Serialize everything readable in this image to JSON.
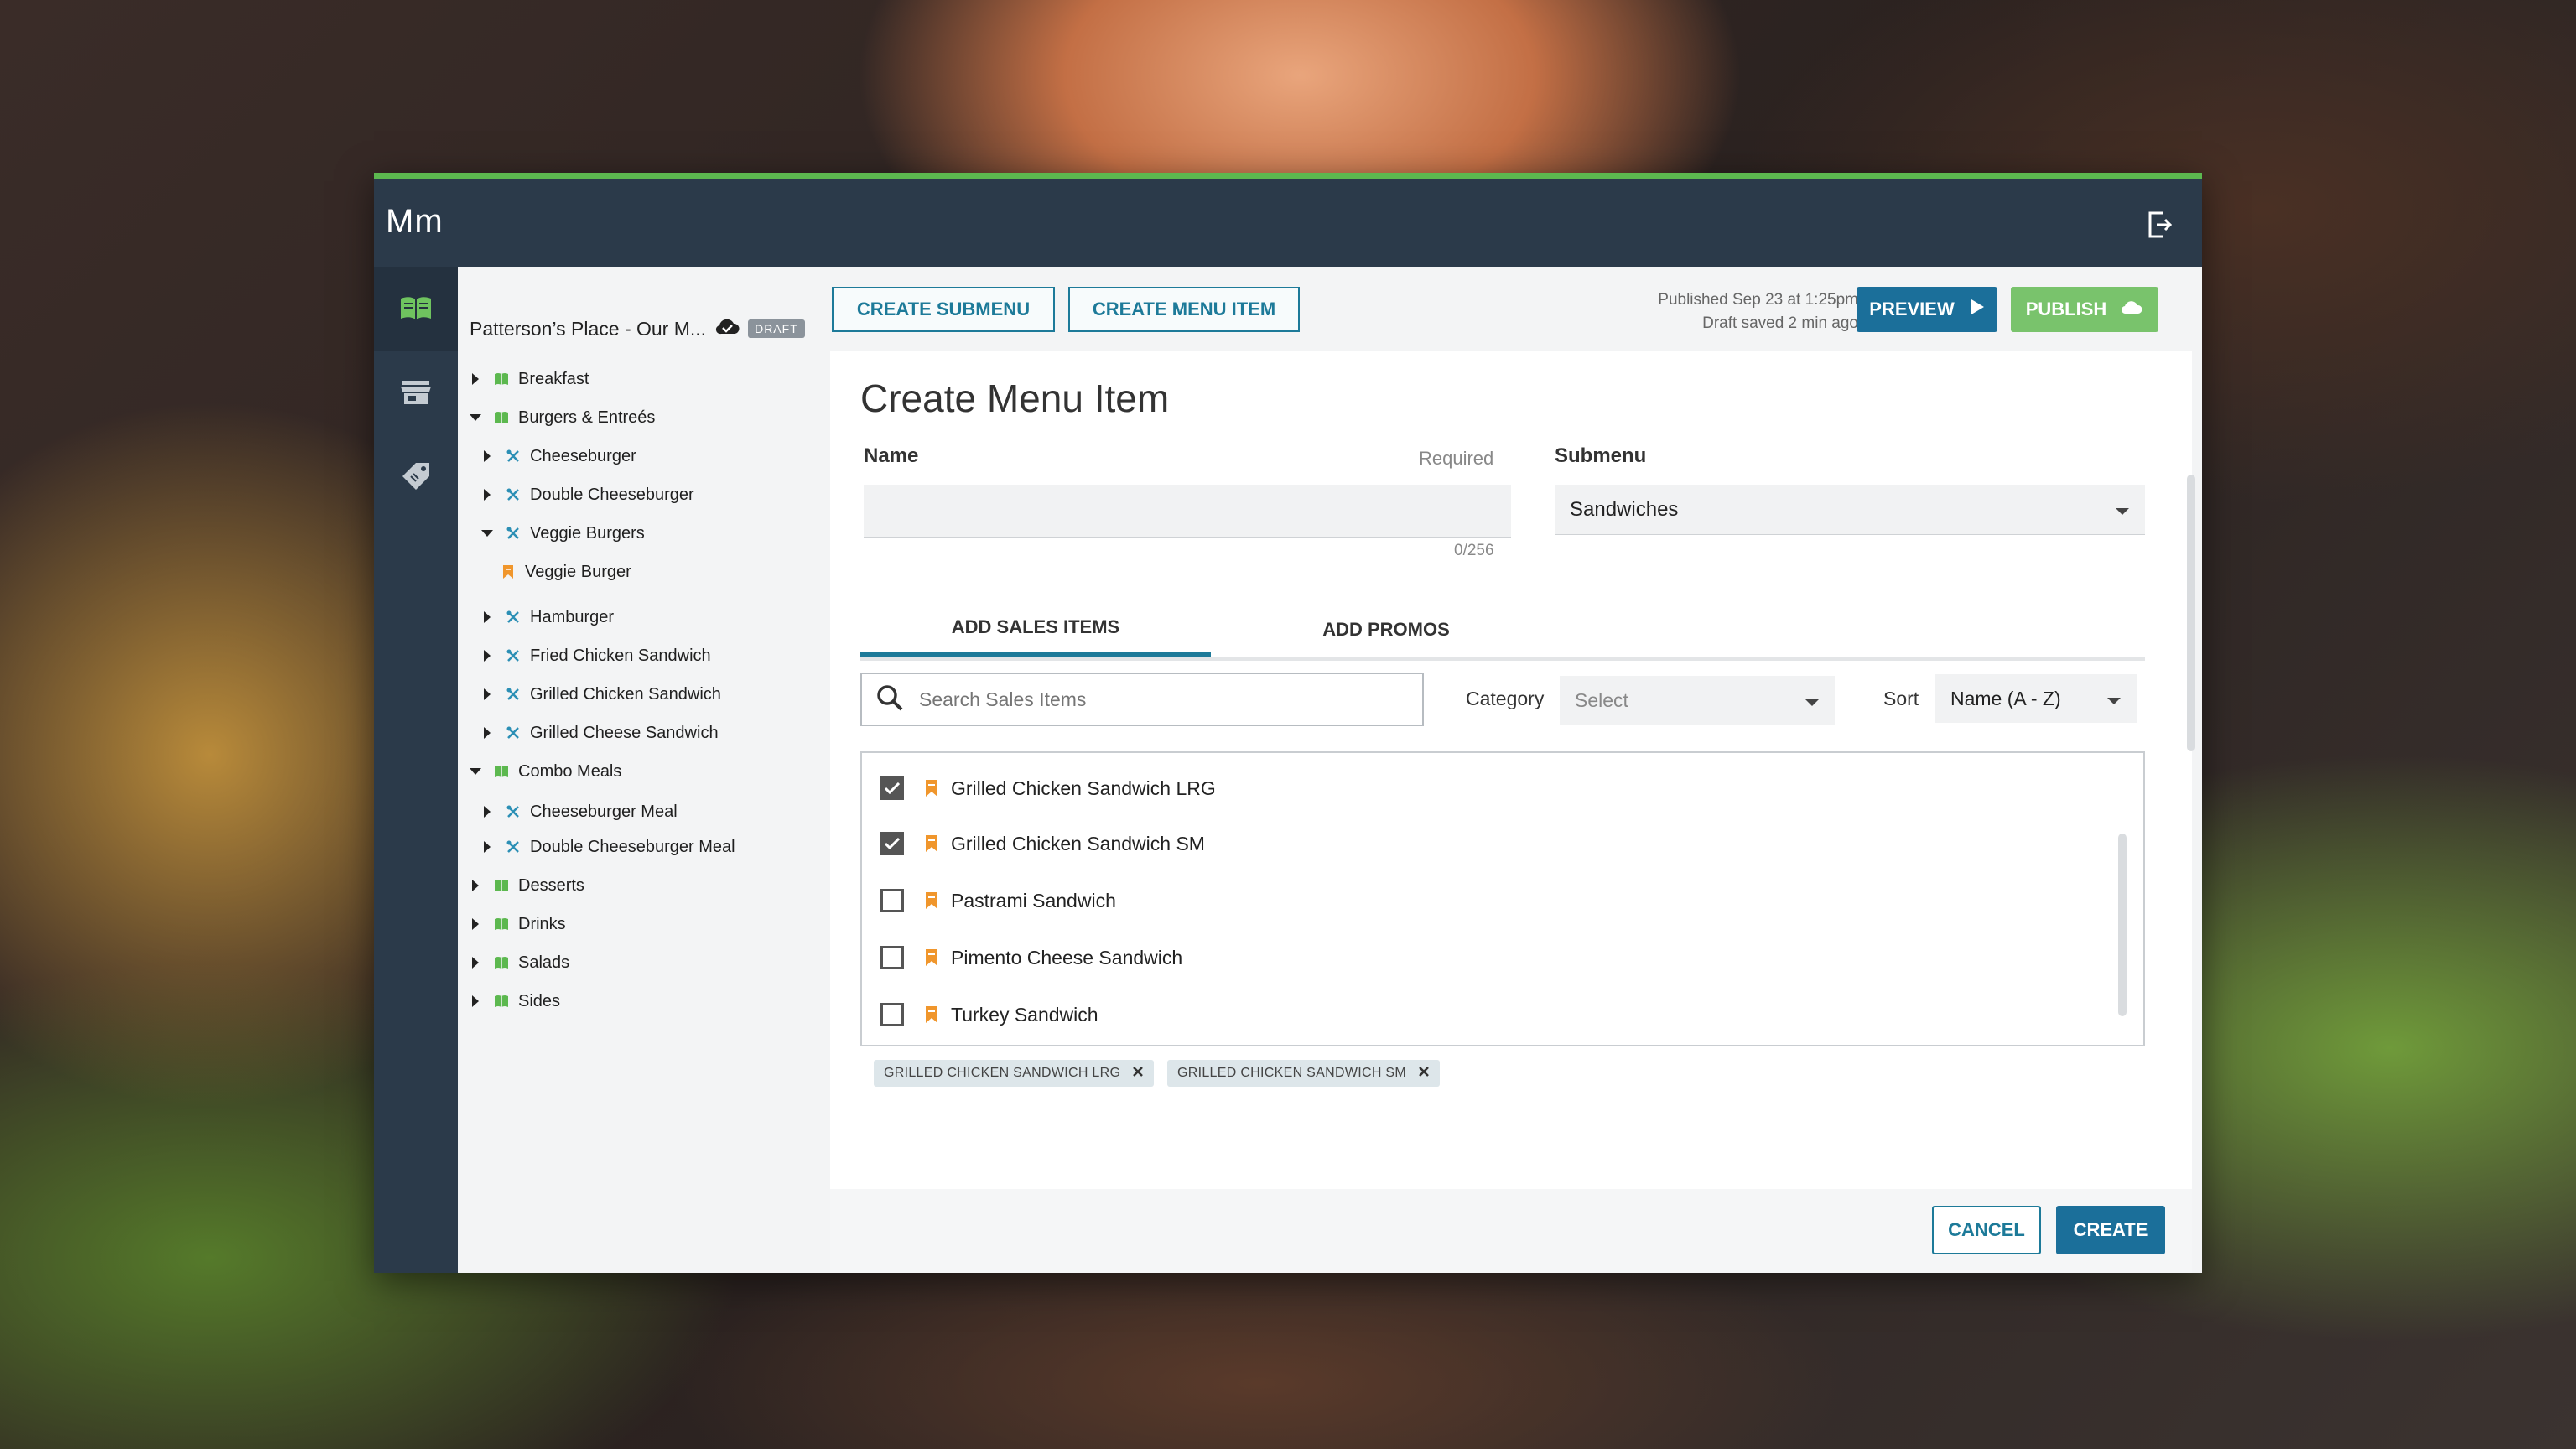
{
  "app": {
    "logo": "Mm"
  },
  "tree": {
    "title": "Patterson’s Place - Our M...",
    "badge": "DRAFT",
    "items": [
      {
        "label": "Breakfast",
        "level": 0,
        "expanded": false,
        "icon": "menu-book-icon"
      },
      {
        "label": "Burgers & Entreés",
        "level": 0,
        "expanded": true,
        "icon": "menu-book-icon"
      },
      {
        "label": "Cheeseburger",
        "level": 1,
        "expanded": false,
        "icon": "utensils-icon"
      },
      {
        "label": "Double Cheeseburger",
        "level": 1,
        "expanded": false,
        "icon": "utensils-icon"
      },
      {
        "label": "Veggie Burgers",
        "level": 1,
        "expanded": true,
        "icon": "utensils-icon"
      },
      {
        "label": "Veggie Burger",
        "level": 2,
        "expanded": false,
        "icon": "bookmark-icon"
      },
      {
        "label": "Hamburger",
        "level": 1,
        "expanded": false,
        "icon": "utensils-icon"
      },
      {
        "label": "Fried Chicken Sandwich",
        "level": 1,
        "expanded": false,
        "icon": "utensils-icon"
      },
      {
        "label": "Grilled Chicken Sandwich",
        "level": 1,
        "expanded": false,
        "icon": "utensils-icon"
      },
      {
        "label": "Grilled Cheese Sandwich",
        "level": 1,
        "expanded": false,
        "icon": "utensils-icon"
      },
      {
        "label": "Combo Meals",
        "level": 0,
        "expanded": true,
        "icon": "menu-book-icon"
      },
      {
        "label": "Cheeseburger Meal",
        "level": 1,
        "expanded": false,
        "icon": "utensils-icon"
      },
      {
        "label": "Double Cheeseburger Meal",
        "level": 1,
        "expanded": false,
        "icon": "utensils-icon"
      },
      {
        "label": "Desserts",
        "level": 0,
        "expanded": false,
        "icon": "menu-book-icon"
      },
      {
        "label": "Drinks",
        "level": 0,
        "expanded": false,
        "icon": "menu-book-icon"
      },
      {
        "label": "Salads",
        "level": 0,
        "expanded": false,
        "icon": "menu-book-icon"
      },
      {
        "label": "Sides",
        "level": 0,
        "expanded": false,
        "icon": "menu-book-icon"
      }
    ]
  },
  "toolbar": {
    "create_submenu": "CREATE SUBMENU",
    "create_menu_item": "CREATE MENU ITEM",
    "published": "Published Sep 23 at 1:25pm",
    "draft_saved": "Draft saved 2 min ago",
    "preview": "PREVIEW",
    "publish": "PUBLISH"
  },
  "form": {
    "title": "Create Menu Item",
    "name_label": "Name",
    "required": "Required",
    "name_value": "",
    "counter": "0/256",
    "submenu_label": "Submenu",
    "submenu_value": "Sandwiches",
    "tabs": [
      "ADD SALES ITEMS",
      "ADD PROMOS"
    ],
    "search_placeholder": "Search Sales Items",
    "category_label": "Category",
    "category_value": "Select",
    "sort_label": "Sort",
    "sort_value": "Name (A - Z)",
    "sales_items": [
      {
        "label": "Grilled Chicken Sandwich LRG",
        "checked": true
      },
      {
        "label": "Grilled Chicken Sandwich SM",
        "checked": true
      },
      {
        "label": "Pastrami Sandwich",
        "checked": false
      },
      {
        "label": "Pimento Cheese Sandwich",
        "checked": false
      },
      {
        "label": "Turkey Sandwich",
        "checked": false
      }
    ],
    "chips": [
      "GRILLED CHICKEN SANDWICH LRG",
      "GRILLED CHICKEN SANDWICH SM"
    ],
    "cancel": "CANCEL",
    "create": "CREATE"
  },
  "colors": {
    "nav_dark": "#2b3a4a",
    "accent_green": "#5cb84f",
    "primary_blue": "#1b6f9a",
    "publish_green": "#79c36c",
    "item_orange": "#f0962c",
    "menu_green": "#5cb84f",
    "utensil_blue": "#2b8fb5"
  }
}
